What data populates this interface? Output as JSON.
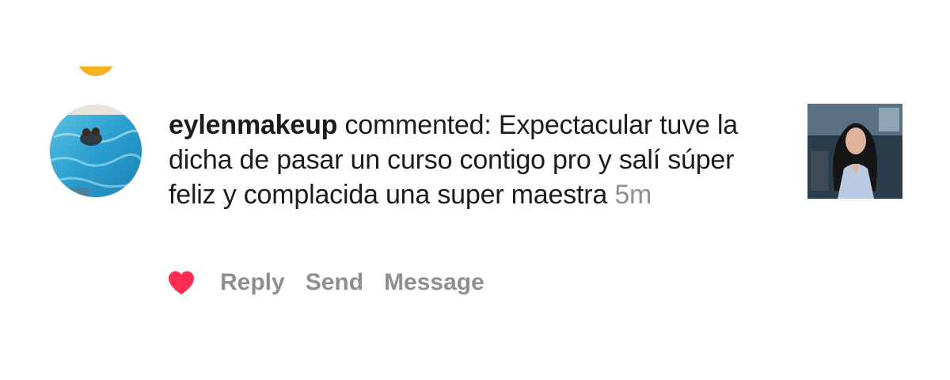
{
  "comment": {
    "username": "eylenmakeup",
    "verb": "commented:",
    "text": "Expectacular tuve la dicha de pasar un curso contigo pro y salí súper feliz y complacida una super maestra",
    "timestamp": "5m"
  },
  "actions": {
    "like_icon": "heart-icon",
    "reply_label": "Reply",
    "send_label": "Send",
    "message_label": "Message"
  },
  "colors": {
    "heart": "#ff2d55",
    "secondary_text": "#8e8e93",
    "primary_text": "#1c1c1e",
    "accent_partial_avatar": "#f5b21f"
  }
}
